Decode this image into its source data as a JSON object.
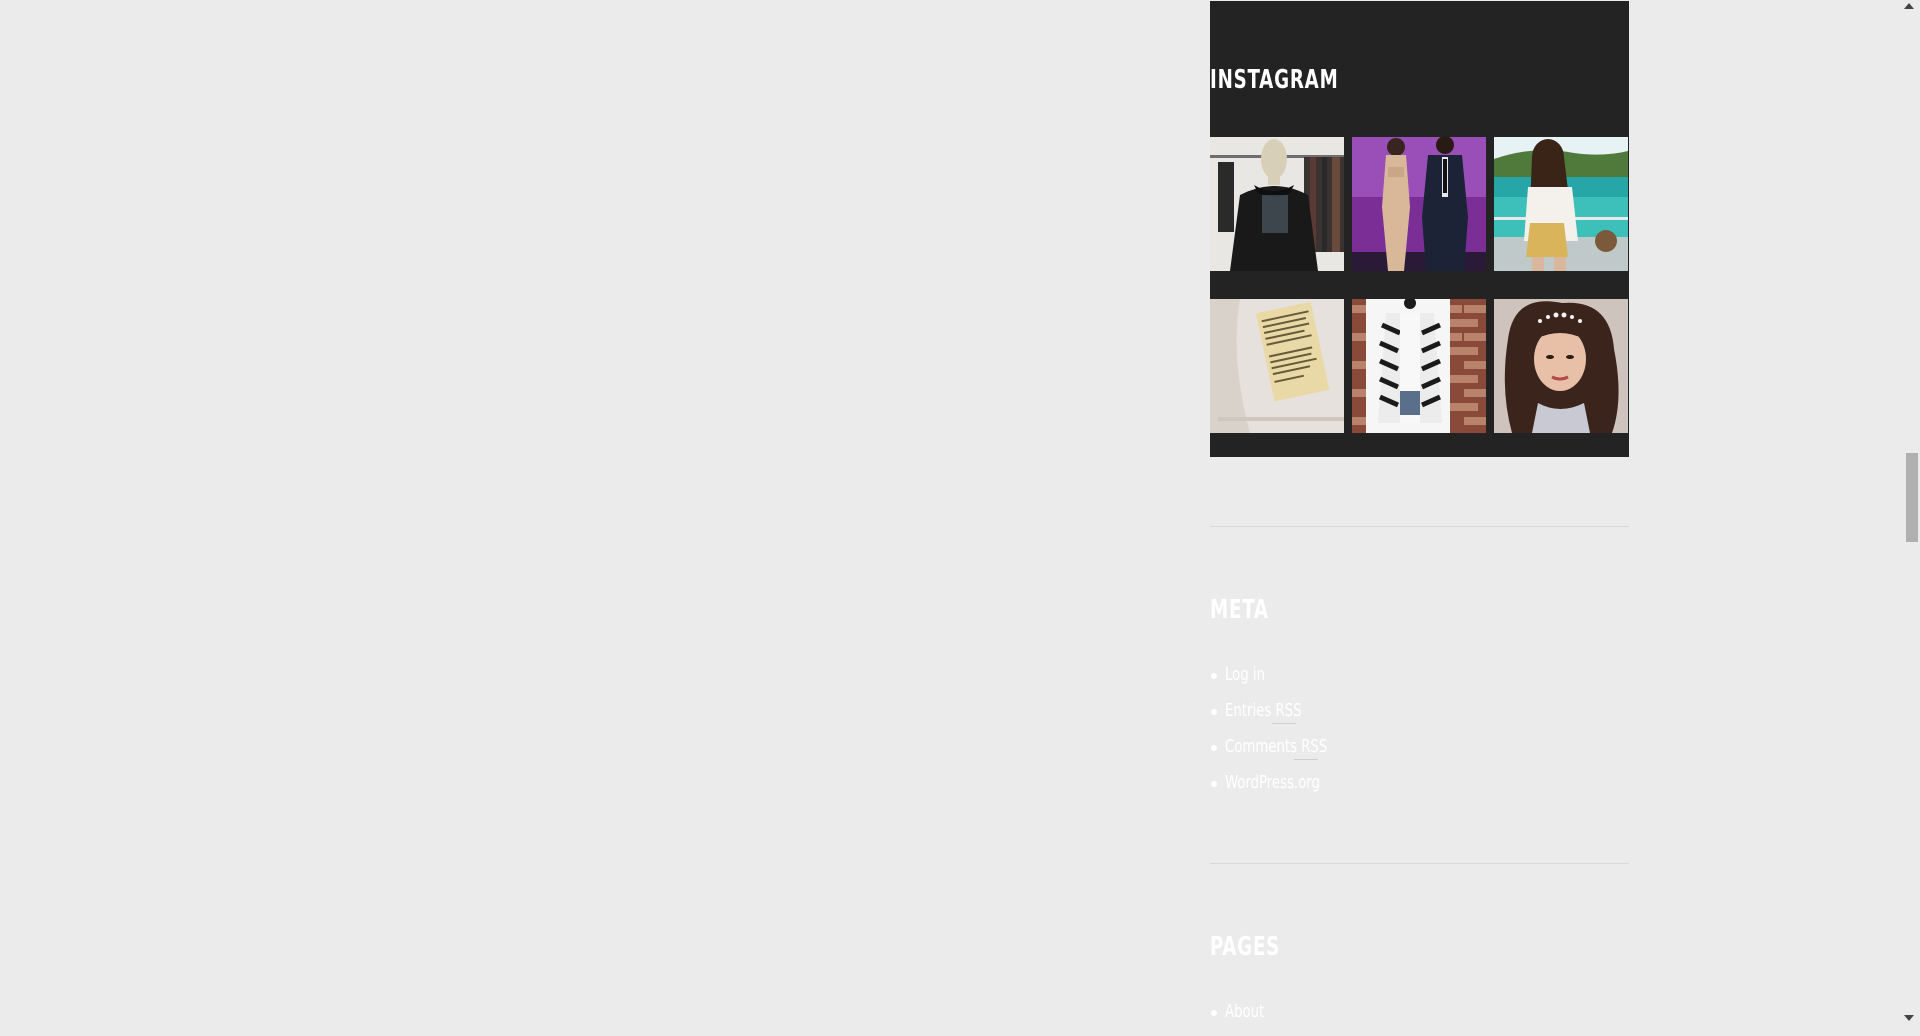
{
  "instagram": {
    "title": "INSTAGRAM",
    "images": [
      {
        "name": "mannequin-black-blouse-photo"
      },
      {
        "name": "stage-couple-photo"
      },
      {
        "name": "beach-balcony-photo"
      },
      {
        "name": "garment-label-photo"
      },
      {
        "name": "zebra-cardigan-photo"
      },
      {
        "name": "tiara-portrait-photo"
      }
    ]
  },
  "meta": {
    "title": "META",
    "links": [
      "Log in",
      "Entries RSS",
      "Comments RSS",
      "WordPress.org"
    ]
  },
  "pages": {
    "title": "PAGES",
    "links": [
      "About"
    ]
  }
}
